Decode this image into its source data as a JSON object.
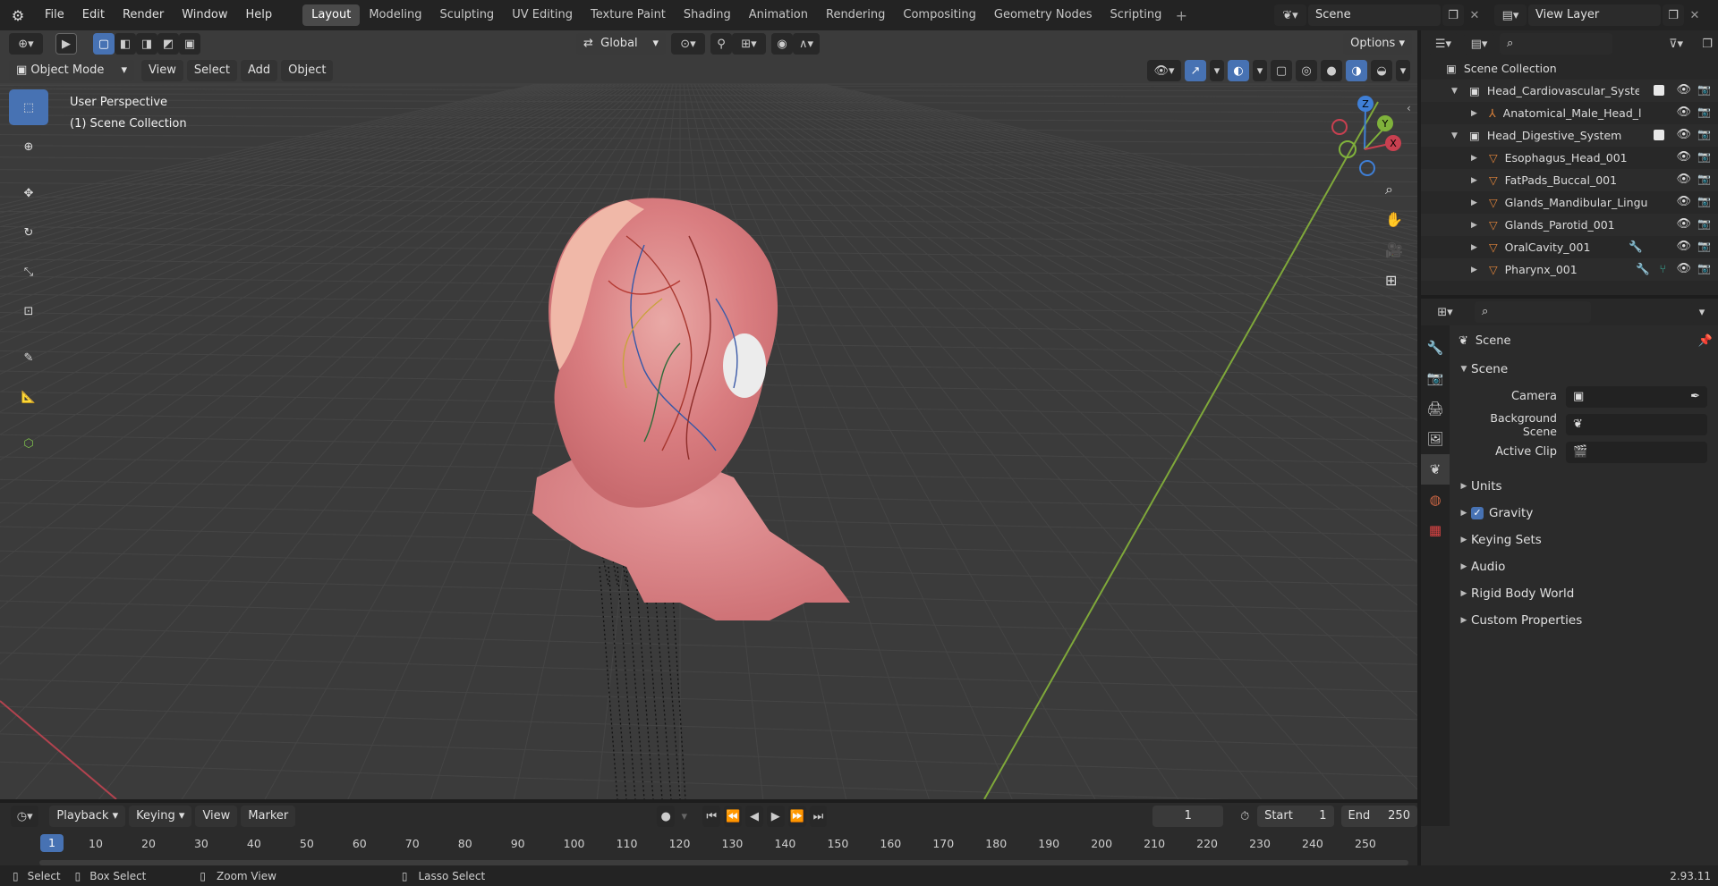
{
  "app_menu": [
    "File",
    "Edit",
    "Render",
    "Window",
    "Help"
  ],
  "workspaces": [
    "Layout",
    "Modeling",
    "Sculpting",
    "UV Editing",
    "Texture Paint",
    "Shading",
    "Animation",
    "Rendering",
    "Compositing",
    "Geometry Nodes",
    "Scripting"
  ],
  "active_workspace": "Layout",
  "scene_field": "Scene",
  "view_layer_field": "View Layer",
  "viewport": {
    "transform_orientation": "Global",
    "options_label": "Options",
    "mode": "Object Mode",
    "menus": [
      "View",
      "Select",
      "Add",
      "Object"
    ],
    "overlay_title": "User Perspective",
    "overlay_collection": "(1) Scene Collection",
    "gizmo_axes": [
      "Z",
      "Y",
      "X"
    ]
  },
  "outliner": {
    "root": "Scene Collection",
    "rows": [
      {
        "label": "Head_Cardiovascular_System",
        "indent": 1,
        "type": "collection",
        "expanded": true
      },
      {
        "label": "Anatomical_Male_Head_l",
        "indent": 2,
        "type": "armature"
      },
      {
        "label": "Head_Digestive_System",
        "indent": 1,
        "type": "collection",
        "expanded": true
      },
      {
        "label": "Esophagus_Head_001",
        "indent": 2,
        "type": "mesh"
      },
      {
        "label": "FatPads_Buccal_001",
        "indent": 2,
        "type": "mesh"
      },
      {
        "label": "Glands_Mandibular_Lingu",
        "indent": 2,
        "type": "mesh"
      },
      {
        "label": "Glands_Parotid_001",
        "indent": 2,
        "type": "mesh"
      },
      {
        "label": "OralCavity_001",
        "indent": 2,
        "type": "mesh"
      },
      {
        "label": "Pharynx_001",
        "indent": 2,
        "type": "mesh"
      }
    ]
  },
  "properties": {
    "context_label": "Scene",
    "panel_scene": "Scene",
    "camera_label": "Camera",
    "background_scene_label": "Background Scene",
    "active_clip_label": "Active Clip",
    "subpanels": [
      "Units",
      "Gravity",
      "Keying Sets",
      "Audio",
      "Rigid Body World",
      "Custom Properties"
    ],
    "gravity_checked": true
  },
  "timeline": {
    "menus": [
      "Playback",
      "Keying",
      "View",
      "Marker"
    ],
    "current_frame": "1",
    "start_label": "Start",
    "start_value": "1",
    "end_label": "End",
    "end_value": "250",
    "ticks": [
      "1",
      "10",
      "20",
      "30",
      "40",
      "50",
      "60",
      "70",
      "80",
      "90",
      "100",
      "110",
      "120",
      "130",
      "140",
      "150",
      "160",
      "170",
      "180",
      "190",
      "200",
      "210",
      "220",
      "230",
      "240",
      "250"
    ]
  },
  "statusbar": {
    "select": "Select",
    "box_select": "Box Select",
    "zoom_view": "Zoom View",
    "lasso_select": "Lasso Select",
    "version": "2.93.11"
  },
  "colors": {
    "accent": "#4772b3",
    "x_axis": "#c94050",
    "y_axis": "#7fb23b",
    "z_axis": "#3f7fd6"
  }
}
